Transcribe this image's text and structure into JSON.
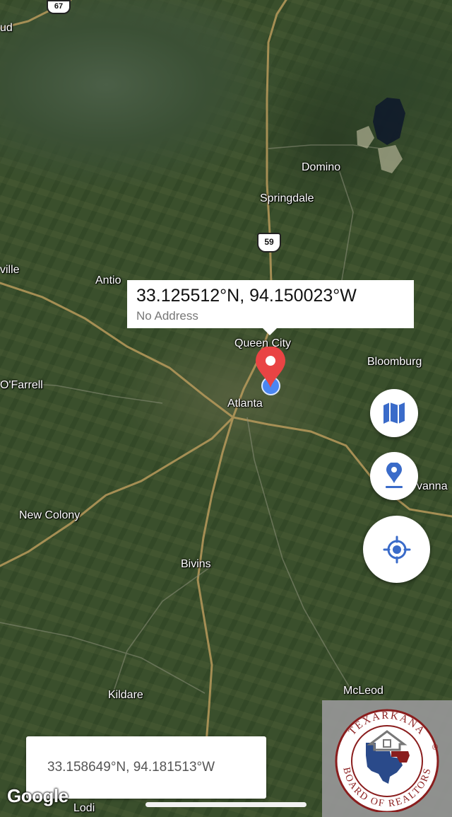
{
  "map": {
    "places": [
      {
        "id": "dud",
        "name": "ud"
      },
      {
        "id": "domino",
        "name": "Domino"
      },
      {
        "id": "springdale",
        "name": "Springdale"
      },
      {
        "id": "ville",
        "name": "ville"
      },
      {
        "id": "antioch",
        "name": "Antio"
      },
      {
        "id": "queen-city",
        "name": "Queen City"
      },
      {
        "id": "bloomburg",
        "name": "Bloomburg"
      },
      {
        "id": "ofarrell",
        "name": "O'Farrell"
      },
      {
        "id": "atlanta",
        "name": "Atlanta"
      },
      {
        "id": "avanna",
        "name": "vanna"
      },
      {
        "id": "new-colony",
        "name": "New Colony"
      },
      {
        "id": "bivins",
        "name": "Bivins"
      },
      {
        "id": "mcleod",
        "name": "McLeod"
      },
      {
        "id": "kildare",
        "name": "Kildare"
      },
      {
        "id": "lodi",
        "name": "Lodi"
      }
    ],
    "shields": {
      "us59": "59",
      "tx67": "67"
    },
    "attribution": "Google"
  },
  "callout": {
    "coords": "33.125512°N, 94.150023°W",
    "address": "No Address"
  },
  "buttons": {
    "map_type": "map-icon",
    "drop_pin": "location-pin-icon",
    "my_location": "gps-target-icon"
  },
  "coordinate_box": {
    "value": "33.158649°N, 94.181513°W"
  },
  "logo": {
    "top_text": "TEXARKANA",
    "bottom_text": "BOARD OF REALTORS",
    "mark": "®"
  },
  "colors": {
    "pin_red": "#e94444",
    "accent_blue": "#3a6bc9",
    "location_dot": "#4a86f2"
  }
}
